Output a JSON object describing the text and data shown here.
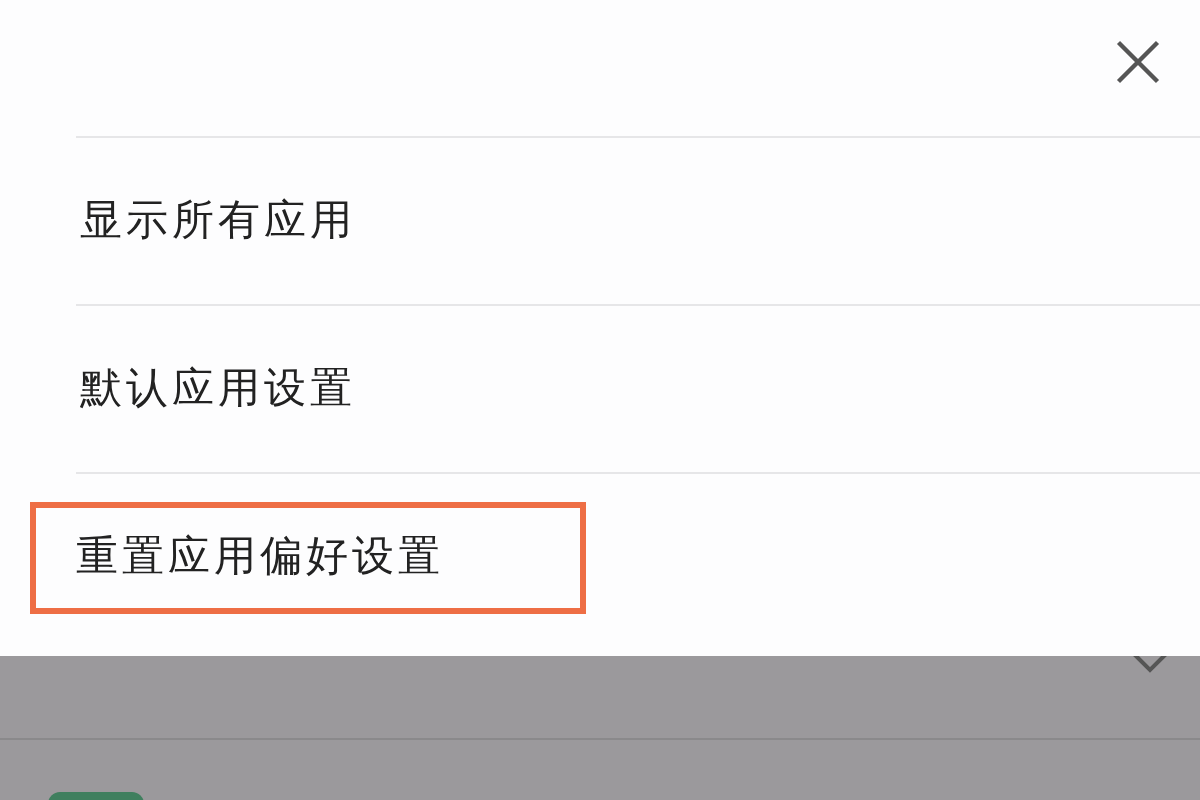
{
  "menu": {
    "items": [
      {
        "label": "显示所有应用",
        "highlighted": false
      },
      {
        "label": "默认应用设置",
        "highlighted": false
      },
      {
        "label": "重置应用偏好设置",
        "highlighted": true
      }
    ]
  }
}
